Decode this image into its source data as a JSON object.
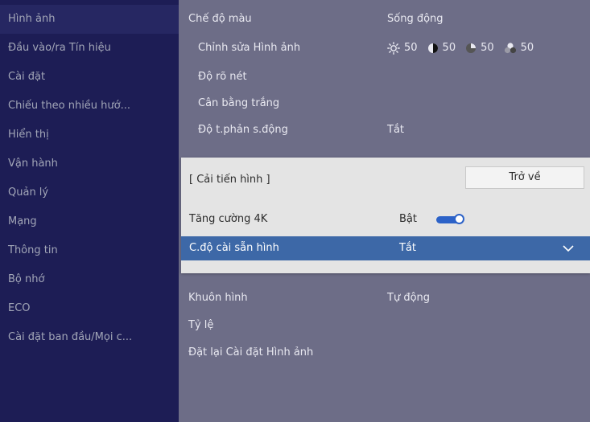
{
  "sidebar": {
    "items": [
      {
        "label": "Hình ảnh"
      },
      {
        "label": "Đầu vào/ra Tín hiệu"
      },
      {
        "label": "Cài đặt"
      },
      {
        "label": "Chiếu theo nhiều hướ..."
      },
      {
        "label": "Hiển thị"
      },
      {
        "label": "Vận hành"
      },
      {
        "label": "Quản lý"
      },
      {
        "label": "Mạng"
      },
      {
        "label": "Thông tin"
      },
      {
        "label": "Bộ nhớ"
      },
      {
        "label": "ECO"
      },
      {
        "label": "Cài đặt ban đầu/Mọi c..."
      }
    ]
  },
  "main": {
    "color_mode": {
      "label": "Chế độ màu",
      "value": "Sống động"
    },
    "image_adjust": {
      "label": "Chỉnh sửa Hình ảnh",
      "brightness": "50",
      "contrast": "50",
      "saturation": "50",
      "tint": "50"
    },
    "sharpness": {
      "label": "Độ rõ nét"
    },
    "white_balance": {
      "label": "Cân bằng trắng"
    },
    "dynamic_contrast": {
      "label": "Độ t.phản s.động",
      "value": "Tắt"
    },
    "aspect_frame": {
      "label": "Khuôn hình",
      "value": "Tự động"
    },
    "aspect": {
      "label": "Tỷ lệ"
    },
    "reset": {
      "label": "Đặt lại Cài đặt Hình ảnh"
    }
  },
  "popup": {
    "title": "[ Cải tiến hình ]",
    "back_label": "Trở về",
    "rows": [
      {
        "label": "Tăng cường 4K",
        "value": "Bật"
      },
      {
        "label": "C.độ cài sẵn hình",
        "value": "Tắt"
      }
    ]
  },
  "colors": {
    "accent": "#3d68a7",
    "toggle": "#2c62c8",
    "sidebar_bg": "#1d1d55"
  }
}
